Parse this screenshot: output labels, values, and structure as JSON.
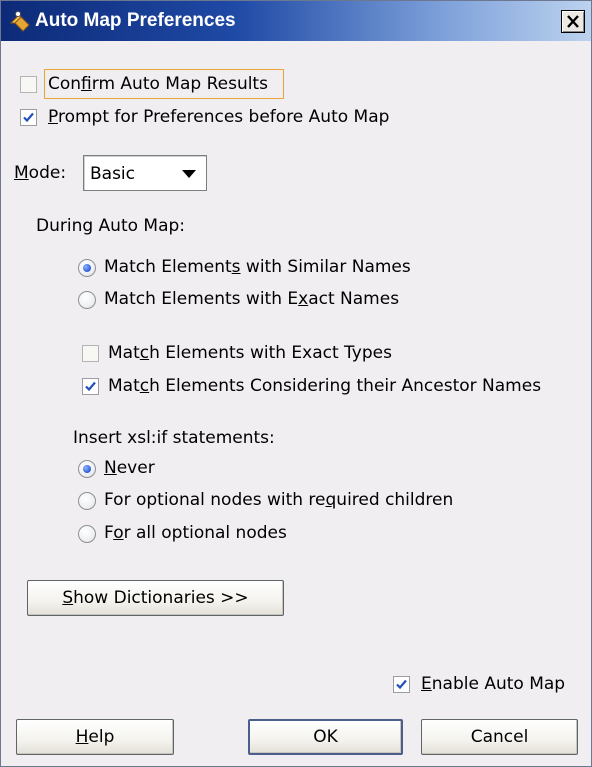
{
  "window": {
    "title": "Auto Map Preferences",
    "close_label": "×"
  },
  "options": {
    "confirm_results": {
      "label_pre": "Con",
      "label_key": "f",
      "label_post": "irm Auto Map Results",
      "checked": false
    },
    "prompt_preferences": {
      "label_pre": "",
      "label_key": "P",
      "label_post": "rompt for Preferences before Auto Map",
      "checked": true
    }
  },
  "mode": {
    "label_key": "M",
    "label_post": "ode:",
    "selected": "Basic"
  },
  "during": {
    "heading": "During Auto Map:",
    "similar": {
      "label_pre": "Match Element",
      "label_key": "s",
      "label_post": " with Similar Names",
      "selected": true
    },
    "exact": {
      "label_pre": "Match Elements with E",
      "label_key": "x",
      "label_post": "act Names",
      "selected": false
    },
    "exact_types": {
      "label_pre": "Mat",
      "label_key": "c",
      "label_post": "h Elements with Exact Types",
      "checked": false
    },
    "ancestor": {
      "label_pre": "Mat",
      "label_key": "c",
      "label_post": "h Elements Considering their Ancestor Names",
      "checked": true
    }
  },
  "xslif": {
    "heading": "Insert xsl:if statements:",
    "never": {
      "label_pre": "",
      "label_key": "N",
      "label_post": "ever",
      "selected": true
    },
    "required_children": {
      "label_pre": "For optional nodes with re",
      "label_key": "q",
      "label_post": "uired children",
      "selected": false
    },
    "all_optional": {
      "label_pre": "F",
      "label_key": "o",
      "label_post": "r all optional nodes",
      "selected": false
    }
  },
  "buttons": {
    "show_dictionaries": {
      "label_key": "S",
      "label_post": "how Dictionaries >>"
    },
    "help": {
      "label_key": "H",
      "label_post": "elp"
    },
    "ok": "OK",
    "cancel": "Cancel"
  },
  "enable_auto_map": {
    "label_key": "E",
    "label_post": "nable Auto Map",
    "checked": true
  },
  "colors": {
    "titlebar_start": "#0d2a78",
    "dialog_bg": "#f1eef1",
    "focus_outline": "#e7a536",
    "check_mark": "#2150b8"
  }
}
